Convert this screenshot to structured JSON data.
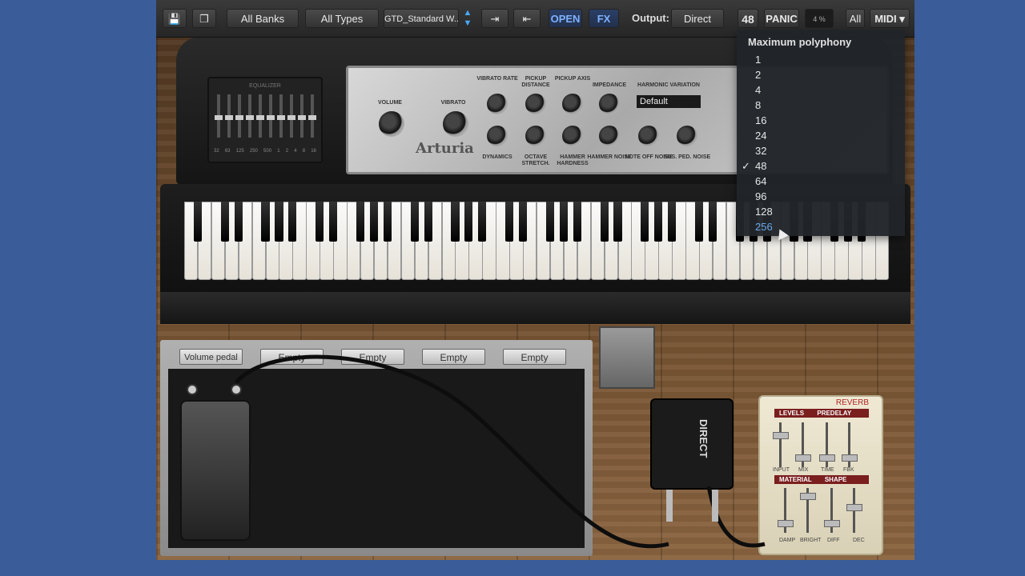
{
  "toolbar": {
    "banks_label": "All Banks",
    "types_label": "All Types",
    "preset_name": "GTD_Standard W...",
    "open_label": "OPEN",
    "fx_label": "FX",
    "output_label": "Output:",
    "output_value": "Direct",
    "polyphony_value": "48",
    "panic_label": "PANIC",
    "cpu_value": "4 %",
    "midi_channel": "All",
    "midi_label": "MIDI ▾"
  },
  "instrument": {
    "equalizer_title": "EQUALIZER",
    "eq_ticks": [
      "32",
      "63",
      "125",
      "250",
      "500",
      "1",
      "2",
      "4",
      "8",
      "16"
    ],
    "logo": "Arturia",
    "knob_labels": {
      "volume": "VOLUME",
      "vibrato": "VIBRATO",
      "vibrato_rate": "VIBRATO RATE",
      "pickup_distance": "PICKUP DISTANCE",
      "pickup_axis": "PICKUP AXIS",
      "impedance": "IMPEDANCE",
      "harmonic_variation": "HARMONIC VARIATION",
      "dynamics": "DYNAMICS",
      "octave_stretch": "OCTAVE STRETCH.",
      "hammer_hardness": "HAMMER HARDNESS",
      "hammer_noise": "HAMMER NOISE",
      "note_off_noise": "NOTE OFF NOISE",
      "sus_ped_noise": "SUS. PED. NOISE"
    },
    "harmonic_variation_value": "Default"
  },
  "pedalboard": {
    "slots": [
      "Volume pedal",
      "Empty",
      "Empty",
      "Empty",
      "Empty"
    ]
  },
  "di_box": {
    "label": "DIRECT"
  },
  "reverb": {
    "title": "REVERB",
    "levels": "LEVELS",
    "predelay": "PREDELAY",
    "material": "MATERIAL",
    "shape": "SHAPE",
    "labels": [
      "INPUT",
      "MIX",
      "TIME",
      "FBK",
      "DAMP",
      "BRIGHT",
      "DIFF",
      "DEC"
    ]
  },
  "polyphony_menu": {
    "title": "Maximum polyphony",
    "options": [
      "1",
      "2",
      "4",
      "8",
      "16",
      "24",
      "32",
      "48",
      "64",
      "96",
      "128",
      "256"
    ],
    "selected": "48",
    "hovered": "256"
  }
}
